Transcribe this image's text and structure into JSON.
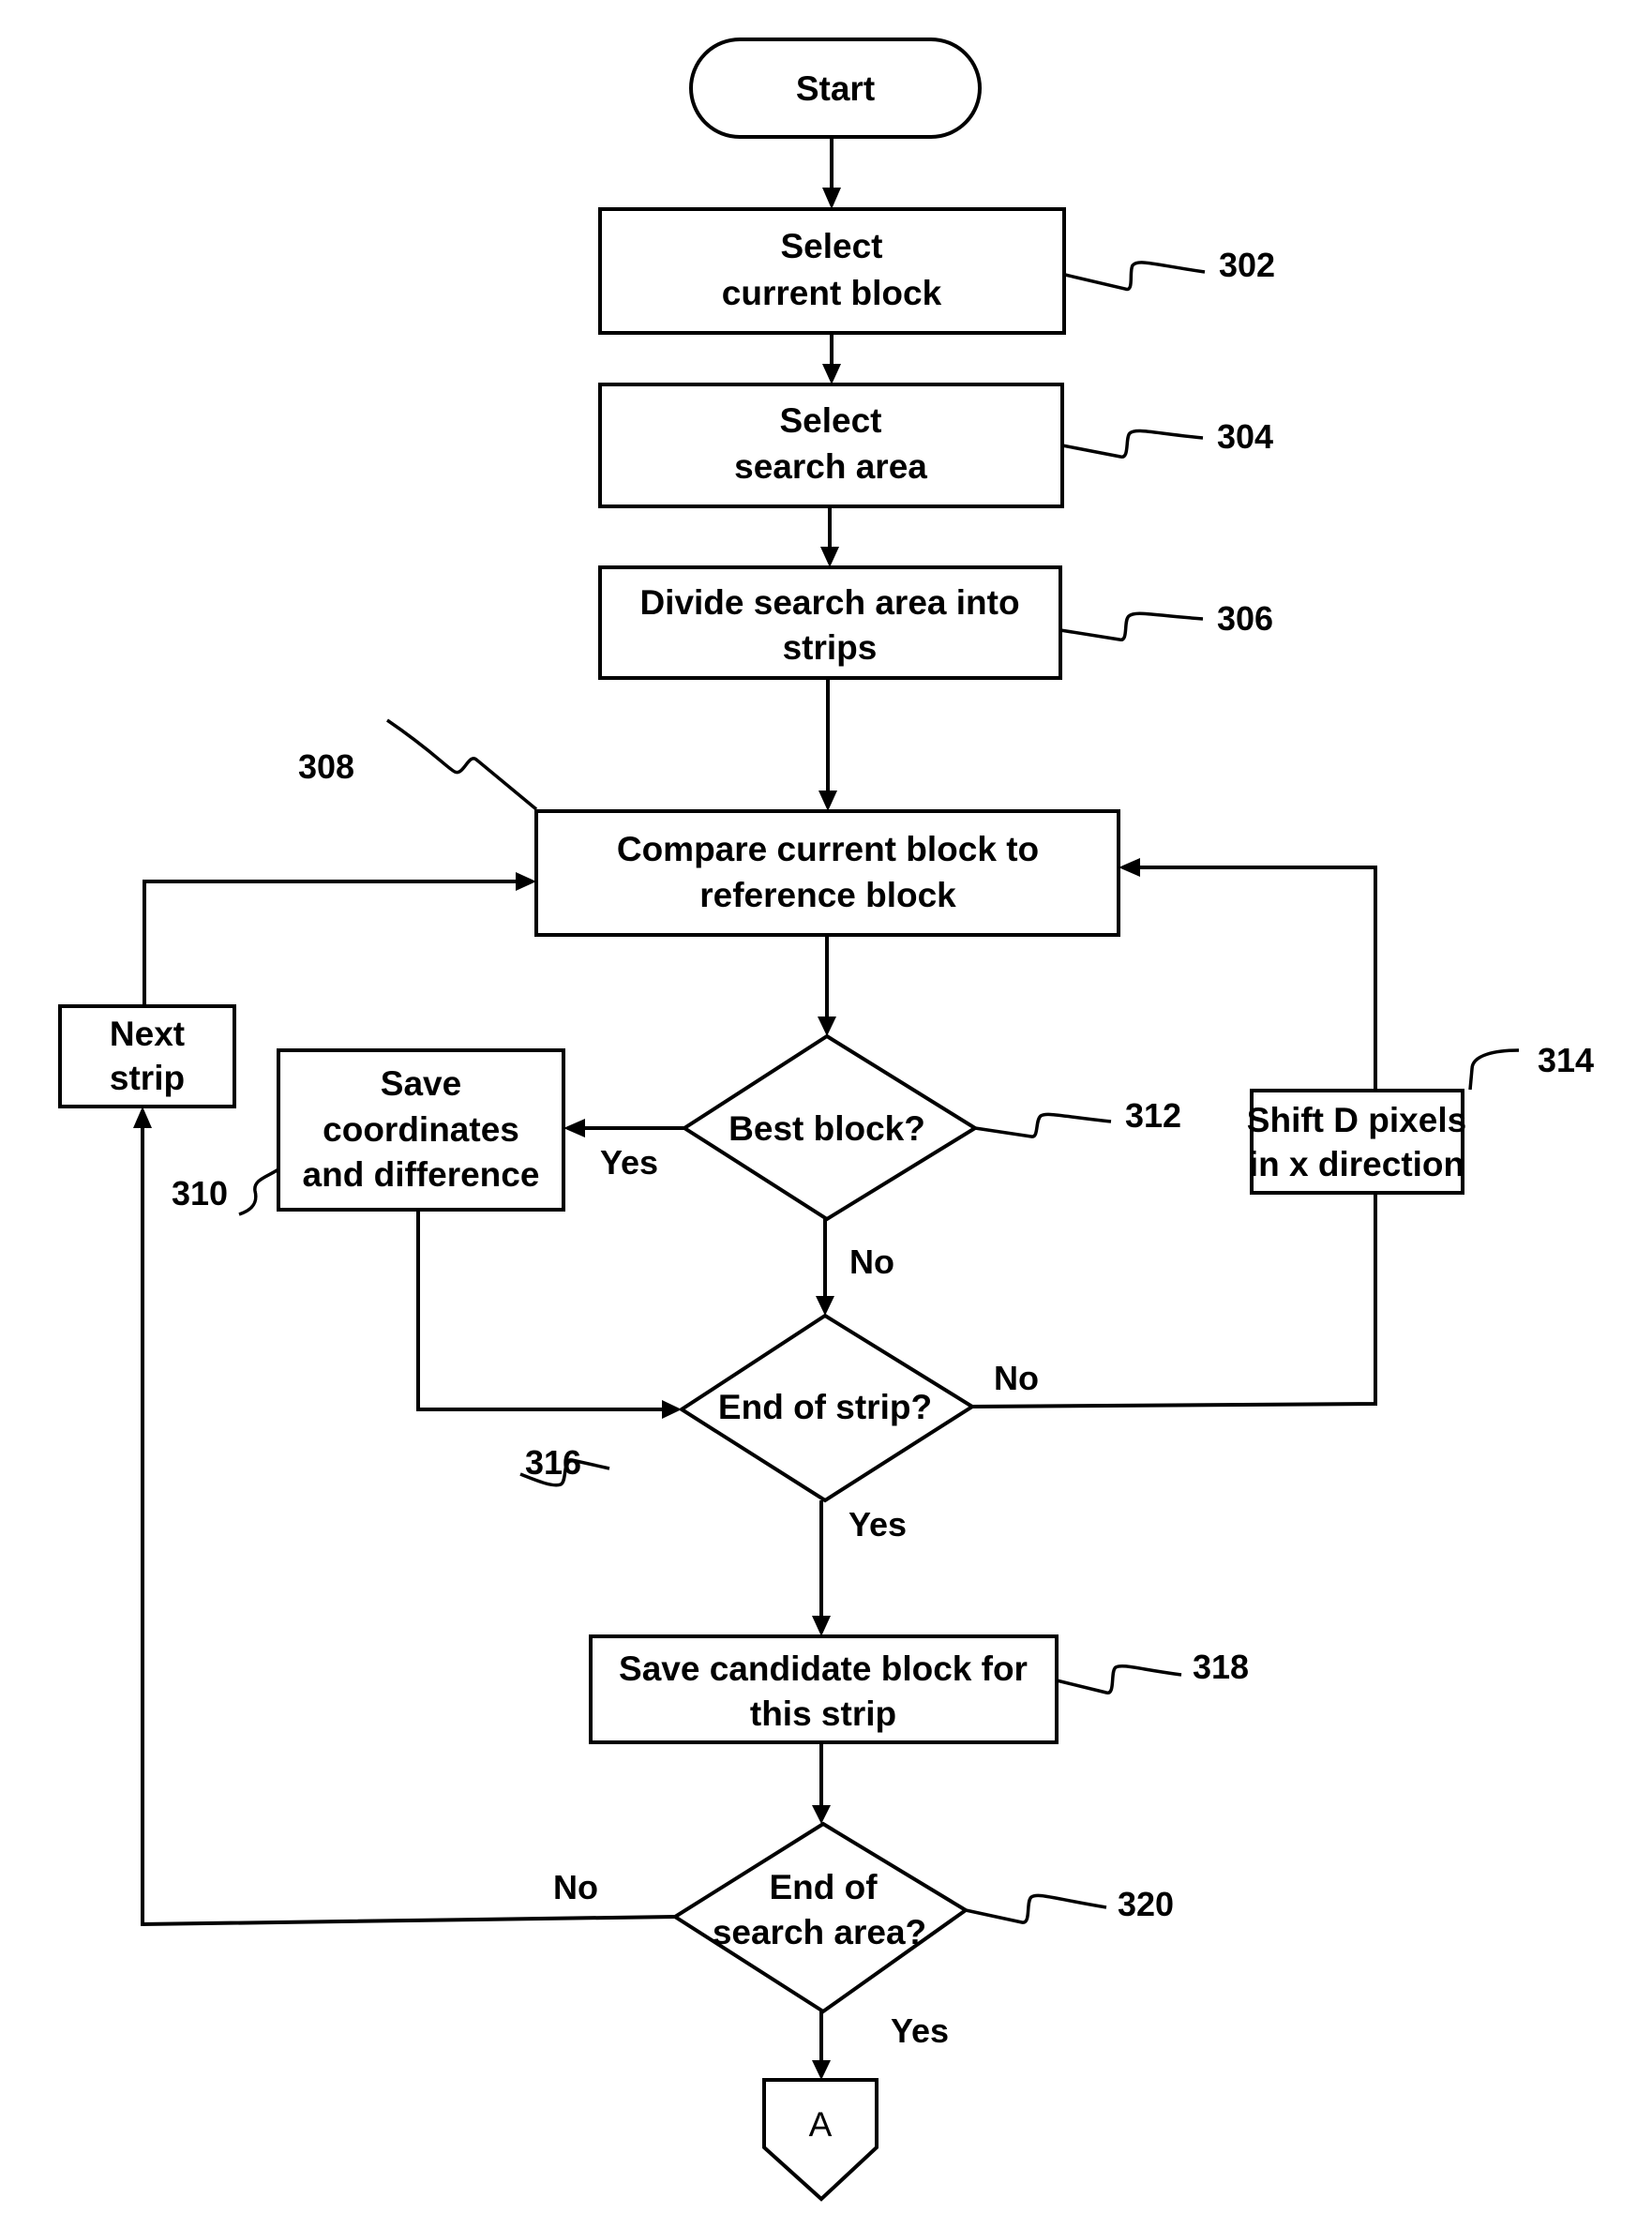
{
  "nodes": {
    "start": {
      "label": "Start"
    },
    "n302": {
      "line1": "Select",
      "line2": "current block",
      "ref": "302"
    },
    "n304": {
      "line1": "Select",
      "line2": "search area",
      "ref": "304"
    },
    "n306": {
      "line1": "Divide search area into",
      "line2": "strips",
      "ref": "306"
    },
    "n308": {
      "line1": "Compare current block to",
      "line2": "reference block",
      "ref": "308"
    },
    "next_strip": {
      "line1": "Next",
      "line2": "strip"
    },
    "n310": {
      "line1": "Save",
      "line2": "coordinates",
      "line3": "and difference",
      "ref": "310"
    },
    "n312": {
      "label": "Best block?",
      "ref": "312"
    },
    "n314": {
      "line1": "Shift D pixels",
      "line2": "in x direction",
      "ref": "314"
    },
    "n316": {
      "label": "End of strip?",
      "ref": "316"
    },
    "n318": {
      "line1": "Save candidate block for",
      "line2": "this strip",
      "ref": "318"
    },
    "n320": {
      "line1": "End of",
      "line2": "search area?",
      "ref": "320"
    },
    "connector_a": {
      "label": "A"
    }
  },
  "edges": {
    "best_yes": "Yes",
    "best_no": "No",
    "strip_no": "No",
    "strip_yes": "Yes",
    "area_no": "No",
    "area_yes": "Yes"
  }
}
